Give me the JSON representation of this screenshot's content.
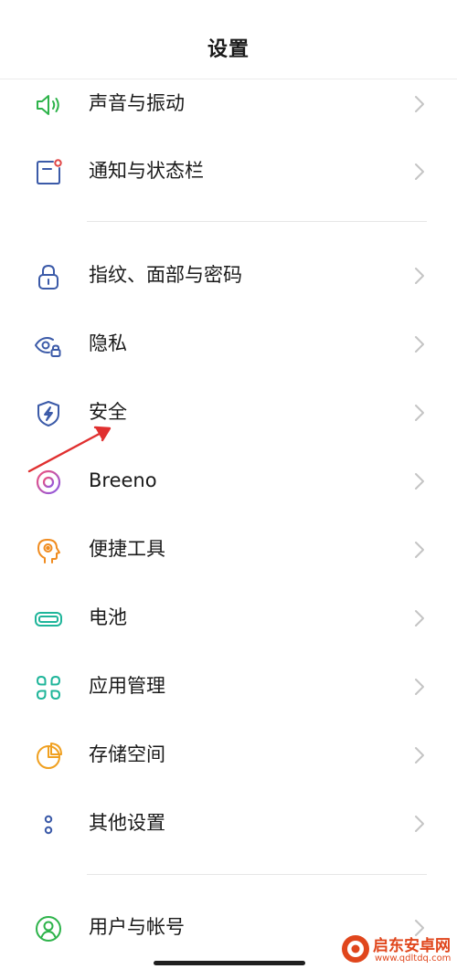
{
  "header": {
    "title": "设置"
  },
  "items": [
    {
      "name": "sound",
      "label": "声音与振动",
      "icon": "speaker-icon",
      "color": "#2db34a"
    },
    {
      "name": "notification",
      "label": "通知与状态栏",
      "icon": "notification-icon",
      "color": "#3b5aa8"
    },
    {
      "name": "fingerprint",
      "label": "指纹、面部与密码",
      "icon": "lock-icon",
      "color": "#3b5aa8"
    },
    {
      "name": "privacy",
      "label": "隐私",
      "icon": "privacy-eye-icon",
      "color": "#3b5aa8"
    },
    {
      "name": "security",
      "label": "安全",
      "icon": "shield-icon",
      "color": "#3b5aa8"
    },
    {
      "name": "breeno",
      "label": "Breeno",
      "icon": "breeno-icon",
      "color": "#d94fb0"
    },
    {
      "name": "shortcuts",
      "label": "便捷工具",
      "icon": "head-gear-icon",
      "color": "#f08c20"
    },
    {
      "name": "battery",
      "label": "电池",
      "icon": "battery-icon",
      "color": "#1fb59a"
    },
    {
      "name": "app-management",
      "label": "应用管理",
      "icon": "apps-icon",
      "color": "#1fb59a"
    },
    {
      "name": "storage",
      "label": "存储空间",
      "icon": "storage-pie-icon",
      "color": "#f0a020"
    },
    {
      "name": "other-settings",
      "label": "其他设置",
      "icon": "more-dots-icon",
      "color": "#3b5aa8"
    },
    {
      "name": "user-account",
      "label": "用户与帐号",
      "icon": "user-icon",
      "color": "#2db34a"
    }
  ],
  "annotation": {
    "color": "#e03030"
  },
  "watermark": {
    "name": "启东安卓网",
    "url": "www.qdltdq.com",
    "color": "#e0461c"
  }
}
